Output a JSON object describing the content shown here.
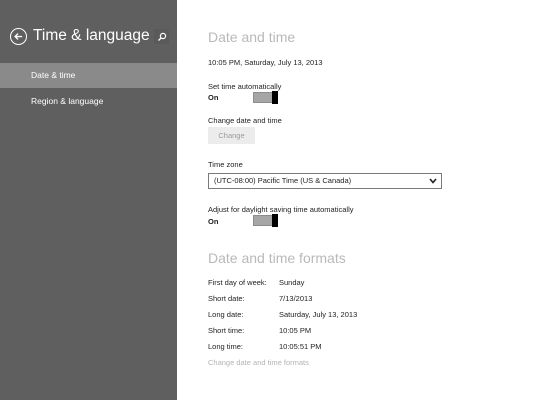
{
  "sidebar": {
    "title": "Time & language",
    "items": [
      {
        "label": "Date & time"
      },
      {
        "label": "Region & language"
      }
    ]
  },
  "date_time": {
    "heading": "Date and time",
    "current": "10:05 PM, Saturday, July 13, 2013",
    "set_auto_label": "Set time automatically",
    "set_auto_state": "On",
    "change_label": "Change date and time",
    "change_button": "Change",
    "timezone_label": "Time zone",
    "timezone_value": "(UTC-08:00) Pacific Time (US & Canada)",
    "dst_label": "Adjust for daylight saving time automatically",
    "dst_state": "On"
  },
  "formats": {
    "heading": "Date and time formats",
    "rows": [
      {
        "label": "First day of week:",
        "value": "Sunday"
      },
      {
        "label": "Short date:",
        "value": "7/13/2013"
      },
      {
        "label": "Long date:",
        "value": "Saturday, July 13, 2013"
      },
      {
        "label": "Short time:",
        "value": "10:05 PM"
      },
      {
        "label": "Long time:",
        "value": "10:05:51 PM"
      }
    ],
    "change_link": "Change date and time formats"
  },
  "colors": {
    "sidebar_bg": "#5f5f5f",
    "selected_bg": "#8a8a8a",
    "heading": "#b9b9b9"
  },
  "icons": [
    "back-arrow-icon",
    "search-icon",
    "chevron-down-icon"
  ]
}
